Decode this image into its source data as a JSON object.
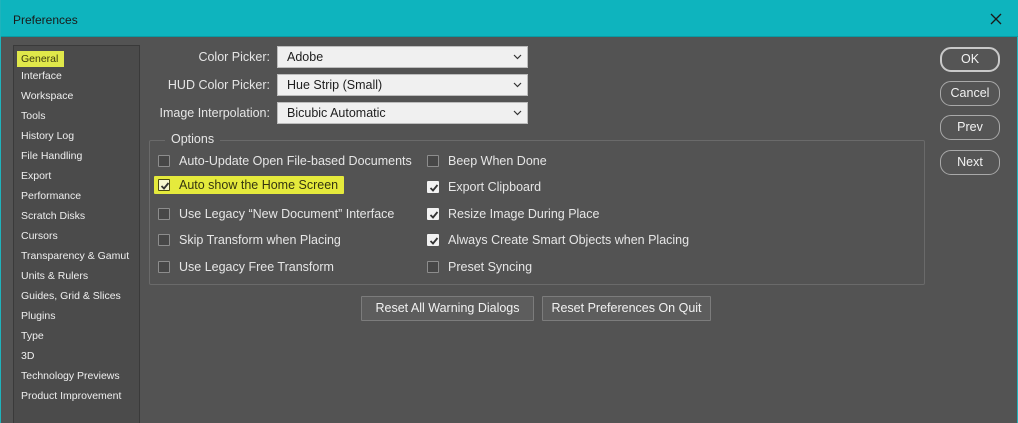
{
  "window": {
    "title": "Preferences",
    "close_icon": "close-icon"
  },
  "sidebar": {
    "items": [
      {
        "label": "General",
        "selected": true
      },
      {
        "label": "Interface"
      },
      {
        "label": "Workspace"
      },
      {
        "label": "Tools"
      },
      {
        "label": "History Log"
      },
      {
        "label": "File Handling"
      },
      {
        "label": "Export"
      },
      {
        "label": "Performance"
      },
      {
        "label": "Scratch Disks"
      },
      {
        "label": "Cursors"
      },
      {
        "label": "Transparency & Gamut"
      },
      {
        "label": "Units & Rulers"
      },
      {
        "label": "Guides, Grid & Slices"
      },
      {
        "label": "Plugins"
      },
      {
        "label": "Type"
      },
      {
        "label": "3D"
      },
      {
        "label": "Technology Previews"
      },
      {
        "label": "Product Improvement"
      }
    ]
  },
  "fields": {
    "color_picker": {
      "label": "Color Picker:",
      "value": "Adobe"
    },
    "hud_color_picker": {
      "label": "HUD Color Picker:",
      "value": "Hue Strip (Small)"
    },
    "image_interpolation": {
      "label": "Image Interpolation:",
      "value": "Bicubic Automatic"
    }
  },
  "options": {
    "legend": "Options",
    "left": [
      {
        "label": "Auto-Update Open File-based Documents",
        "checked": false
      },
      {
        "label": "Auto show the Home Screen",
        "checked": true,
        "highlighted": true
      },
      {
        "label": "Use Legacy “New Document” Interface",
        "checked": false
      },
      {
        "label": "Skip Transform when Placing",
        "checked": false
      },
      {
        "label": "Use Legacy Free Transform",
        "checked": false
      }
    ],
    "right": [
      {
        "label": "Beep When Done",
        "checked": false
      },
      {
        "label": "Export Clipboard",
        "checked": true
      },
      {
        "label": "Resize Image During Place",
        "checked": true
      },
      {
        "label": "Always Create Smart Objects when Placing",
        "checked": true
      },
      {
        "label": "Preset Syncing",
        "checked": false
      }
    ]
  },
  "buttons": {
    "reset_warnings": "Reset All Warning Dialogs",
    "reset_prefs": "Reset Preferences On Quit",
    "ok": "OK",
    "cancel": "Cancel",
    "prev": "Prev",
    "next": "Next"
  },
  "colors": {
    "titlebar": "#0eb4be",
    "highlight": "#e5ea3c",
    "panel": "#535353"
  }
}
